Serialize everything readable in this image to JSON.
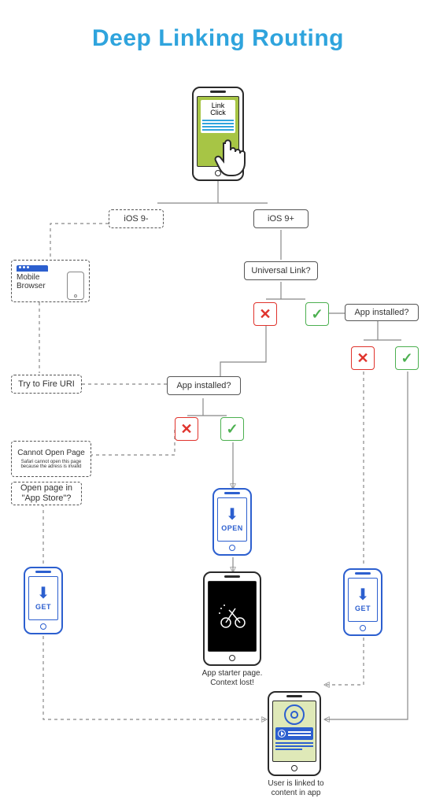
{
  "title": "Deep Linking Routing",
  "start": {
    "label": "Link\nClick"
  },
  "branch_ios_old": "iOS 9-",
  "branch_ios_new": "iOS 9+",
  "universal_link": "Universal Link?",
  "app_installed_left": "App installed?",
  "app_installed_right": "App installed?",
  "mobile_browser": "Mobile\nBrowser",
  "try_fire_uri": "Try to Fire URI",
  "cannot_open": {
    "title": "Cannot Open Page",
    "sub": "Safari cannot open this page because the adress is invalid"
  },
  "open_in_store": "Open page in \"App Store\"?",
  "store_get": "GET",
  "store_open": "OPEN",
  "context_lost": "App starter page.\nContext lost!",
  "deep_linked": "User is linked to\ncontent in app",
  "choices": {
    "x": "✕",
    "check": "✓"
  }
}
